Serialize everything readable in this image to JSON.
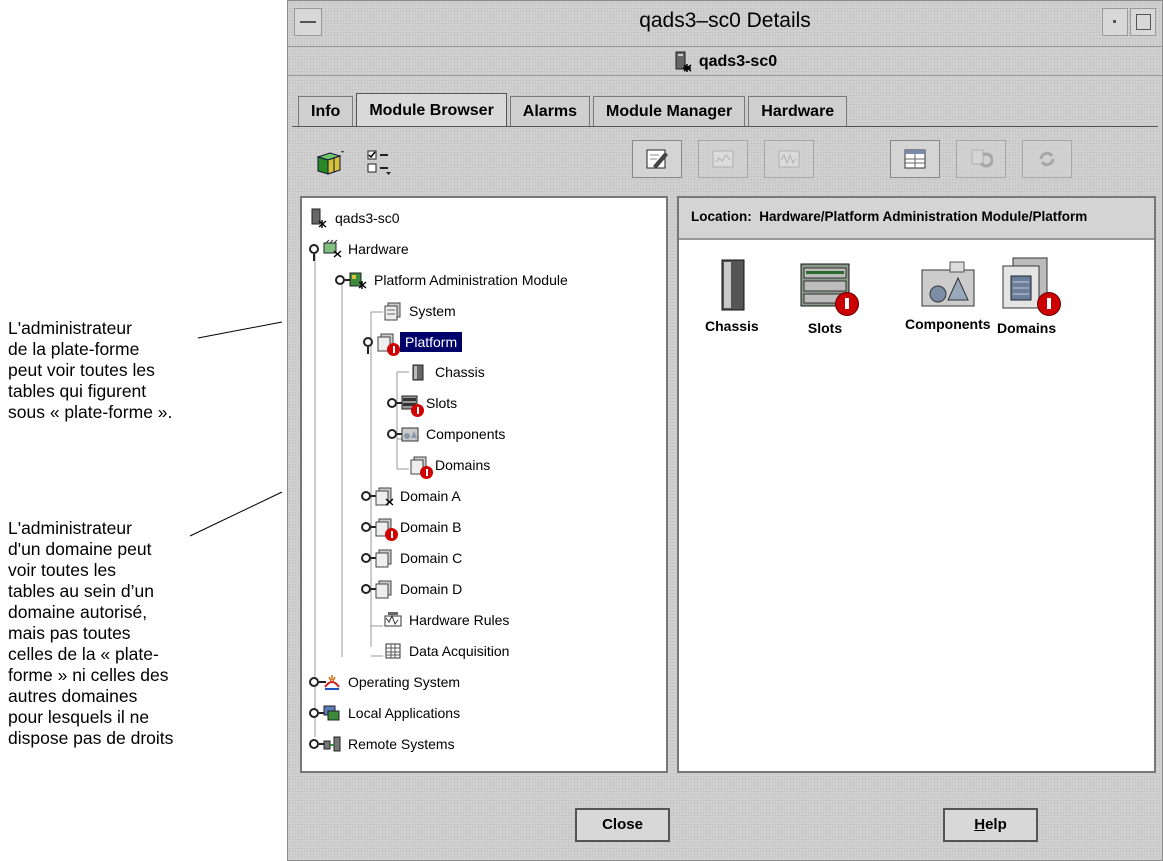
{
  "annotations": {
    "platform_note": "L'administrateur\nde la plate-forme\npeut voir toutes les\ntables qui figurent\nsous « plate-forme ».",
    "domain_note": "L'administrateur\nd'un domaine peut\nvoir toutes les\ntables au sein d’un\ndomaine autorisé,\nmais pas toutes\ncelles de la « plate-\nforme » ni celles des\nautres domaines\npour lesquels il ne\ndispose pas de droits"
  },
  "window": {
    "title": "qads3–sc0 Details",
    "host": "qads3-sc0"
  },
  "tabs": [
    "Info",
    "Module Browser",
    "Alarms",
    "Module Manager",
    "Hardware"
  ],
  "active_tab": "Module Browser",
  "toolbar": {
    "left": [
      "cube-icon",
      "checklist-icon"
    ],
    "right": [
      {
        "name": "edit-icon",
        "enabled": true
      },
      {
        "name": "graph-icon",
        "enabled": false
      },
      {
        "name": "waveform-icon",
        "enabled": false
      },
      {
        "name": "table-icon",
        "enabled": true
      },
      {
        "name": "refresh-icon",
        "enabled": false
      },
      {
        "name": "reload-icon",
        "enabled": false
      }
    ]
  },
  "tree": {
    "root": "qads3-sc0",
    "hardware": "Hardware",
    "platform_admin_module": "Platform Administration Module",
    "system": "System",
    "platform": "Platform",
    "chassis": "Chassis",
    "slots": "Slots",
    "components": "Components",
    "domains": "Domains",
    "domain_a": "Domain A",
    "domain_b": "Domain B",
    "domain_c": "Domain C",
    "domain_d": "Domain D",
    "hardware_rules": "Hardware Rules",
    "data_acquisition": "Data Acquisition",
    "operating_system": "Operating System",
    "local_applications": "Local Applications",
    "remote_systems": "Remote Systems",
    "selected": "Platform"
  },
  "details": {
    "location_label": "Location:",
    "location_path": "Hardware/Platform Administration Module/Platform",
    "icons": {
      "chassis": "Chassis",
      "slots": "Slots",
      "components": "Components",
      "domains": "Domains"
    }
  },
  "buttons": {
    "close": "Close",
    "help": "Help"
  },
  "colors": {
    "selection": "#00006b",
    "alarm": "#cc0000"
  }
}
